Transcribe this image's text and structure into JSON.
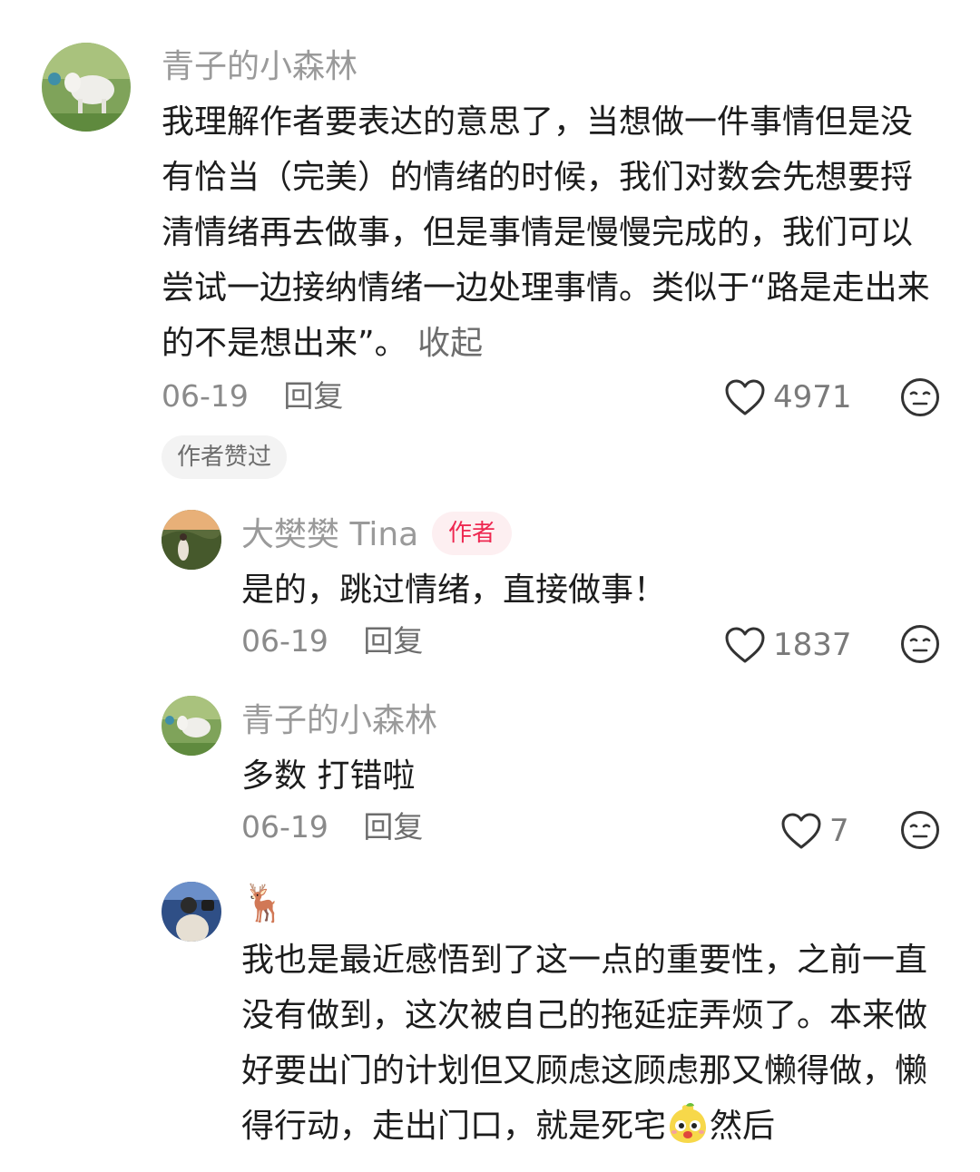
{
  "comments": [
    {
      "username": "青子的小森林",
      "text": "我理解作者要表达的意思了，当想做一件事情但是没有恰当（完美）的情绪的时候，我们对数会先想要捋清情绪再去做事，但是事情是慢慢完成的，我们可以尝试一边接纳情绪一边处理事情。类似于“路是走出来的不是想出来”。",
      "collapse_label": "收起",
      "date": "06-19",
      "reply_label": "回复",
      "likes": "4971",
      "author_liked_tag": "作者赞过"
    }
  ],
  "replies": [
    {
      "username": "大樊樊 Tina",
      "badge": "作者",
      "text": "是的，跳过情绪，直接做事！",
      "date": "06-19",
      "reply_label": "回复",
      "likes": "1837"
    },
    {
      "username": "青子的小森林",
      "text": "多数 打错啦",
      "date": "06-19",
      "reply_label": "回复",
      "likes": "7"
    },
    {
      "username": "🦌",
      "text_before_emoji": "我也是最近感悟到了这一点的重要性，之前一直没有做到，这次被自己的拖延症弄烦了。本来做好要出门的计划但又顾虑这顾虑那又懒得做，懒得行动，走出门口，就是死宅",
      "text_after_emoji": "然后",
      "inline_emoji": "mascot-face-emoji"
    }
  ],
  "icons": {
    "like": "heart-outline-icon",
    "dislike": "neutral-face-icon"
  },
  "colors": {
    "author_badge_text": "#ee2851",
    "author_badge_bg": "#fdeff1",
    "username": "#9a9a9a",
    "secondary": "#8a8a8a"
  }
}
